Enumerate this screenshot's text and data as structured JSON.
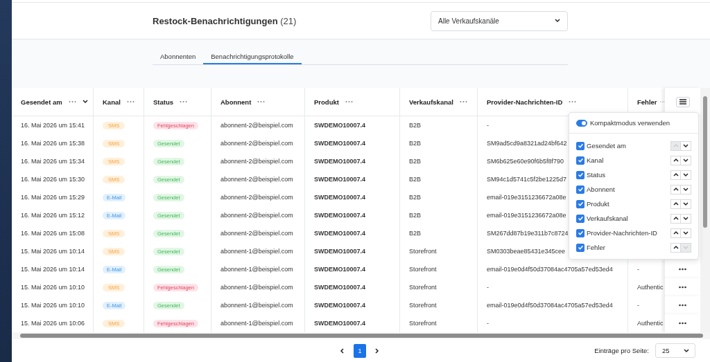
{
  "header": {
    "title": "Restock-Benachrichtigungen",
    "count": "(21)",
    "channel_select": "Alle Verkaufskanäle"
  },
  "tabs": [
    {
      "label": "Abonnenten",
      "selected": false
    },
    {
      "label": "Benachrichtigungsprotokolle",
      "selected": true
    }
  ],
  "table": {
    "columns": [
      {
        "label": "Gesendet am",
        "sortable": true
      },
      {
        "label": "Kanal"
      },
      {
        "label": "Status"
      },
      {
        "label": "Abonnent"
      },
      {
        "label": "Produkt"
      },
      {
        "label": "Verkaufskanal"
      },
      {
        "label": "Provider-Nachrichten-ID"
      },
      {
        "label": "Fehler"
      }
    ],
    "rows": [
      {
        "sent": "16. Mai 2026 um 15:41",
        "channel": {
          "label": "SMS",
          "kind": "sms"
        },
        "status": {
          "label": "Fehlgeschlagen",
          "kind": "failed"
        },
        "subscriber": "abonnent-2@beispiel.com",
        "product": "SWDEMO10007.4",
        "sales_channel": "B2B",
        "provider_id": "-"
      },
      {
        "sent": "16. Mai 2026 um 15:38",
        "channel": {
          "label": "SMS",
          "kind": "sms"
        },
        "status": {
          "label": "Gesendet",
          "kind": "sent"
        },
        "subscriber": "abonnent-2@beispiel.com",
        "product": "SWDEMO10007.4",
        "sales_channel": "B2B",
        "provider_id": "SM9ad5cd9a8321ad24bf642"
      },
      {
        "sent": "16. Mai 2026 um 15:34",
        "channel": {
          "label": "SMS",
          "kind": "sms"
        },
        "status": {
          "label": "Gesendet",
          "kind": "sent"
        },
        "subscriber": "abonnent-2@beispiel.com",
        "product": "SWDEMO10007.4",
        "sales_channel": "B2B",
        "provider_id": "SM6b625e60e90f6b5f8f790"
      },
      {
        "sent": "16. Mai 2026 um 15:30",
        "channel": {
          "label": "SMS",
          "kind": "sms"
        },
        "status": {
          "label": "Gesendet",
          "kind": "sent"
        },
        "subscriber": "abonnent-2@beispiel.com",
        "product": "SWDEMO10007.4",
        "sales_channel": "B2B",
        "provider_id": "SM94c1d5741c5f2be1225d7"
      },
      {
        "sent": "16. Mai 2026 um 15:29",
        "channel": {
          "label": "E-Mail",
          "kind": "email"
        },
        "status": {
          "label": "Gesendet",
          "kind": "sent"
        },
        "subscriber": "abonnent-2@beispiel.com",
        "product": "SWDEMO10007.4",
        "sales_channel": "B2B",
        "provider_id": "email-019e3151236672a08e"
      },
      {
        "sent": "16. Mai 2026 um 15:12",
        "channel": {
          "label": "E-Mail",
          "kind": "email"
        },
        "status": {
          "label": "Gesendet",
          "kind": "sent"
        },
        "subscriber": "abonnent-2@beispiel.com",
        "product": "SWDEMO10007.4",
        "sales_channel": "B2B",
        "provider_id": "email-019e3151236672a08e"
      },
      {
        "sent": "16. Mai 2026 um 15:08",
        "channel": {
          "label": "SMS",
          "kind": "sms"
        },
        "status": {
          "label": "Gesendet",
          "kind": "sent"
        },
        "subscriber": "abonnent-2@beispiel.com",
        "product": "SWDEMO10007.4",
        "sales_channel": "B2B",
        "provider_id": "SM267dd87b19e311b7c8724"
      },
      {
        "sent": "15. Mai 2026 um 10:14",
        "channel": {
          "label": "SMS",
          "kind": "sms"
        },
        "status": {
          "label": "Gesendet",
          "kind": "sent"
        },
        "subscriber": "abonnent-1@beispiel.com",
        "product": "SWDEMO10007.4",
        "sales_channel": "Storefront",
        "provider_id": "SM0303beae85431e345cee"
      },
      {
        "sent": "15. Mai 2026 um 10:14",
        "channel": {
          "label": "E-Mail",
          "kind": "email"
        },
        "status": {
          "label": "Gesendet",
          "kind": "sent"
        },
        "subscriber": "abonnent-1@beispiel.com",
        "product": "SWDEMO10007.4",
        "sales_channel": "Storefront",
        "provider_id": "email-019e0d4f50d37084ac4705a57ed53ed4",
        "error": "-"
      },
      {
        "sent": "15. Mai 2026 um 10:10",
        "channel": {
          "label": "SMS",
          "kind": "sms"
        },
        "status": {
          "label": "Fehlgeschlagen",
          "kind": "failed"
        },
        "subscriber": "abonnent-1@beispiel.com",
        "product": "SWDEMO10007.4",
        "sales_channel": "Storefront",
        "provider_id": "-",
        "error": "Authentic"
      },
      {
        "sent": "15. Mai 2026 um 10:10",
        "channel": {
          "label": "E-Mail",
          "kind": "email"
        },
        "status": {
          "label": "Gesendet",
          "kind": "sent"
        },
        "subscriber": "abonnent-1@beispiel.com",
        "product": "SWDEMO10007.4",
        "sales_channel": "Storefront",
        "provider_id": "email-019e0d4f50d37084ac4705a57ed53ed4",
        "error": "-"
      },
      {
        "sent": "15. Mai 2026 um 10:06",
        "channel": {
          "label": "SMS",
          "kind": "sms"
        },
        "status": {
          "label": "Fehlgeschlagen",
          "kind": "failed"
        },
        "subscriber": "abonnent-1@beispiel.com",
        "product": "SWDEMO10007.4",
        "sales_channel": "Storefront",
        "provider_id": "-",
        "error": "Authentic"
      }
    ]
  },
  "column_menu": {
    "compact": {
      "label": "Kompaktmodus verwenden",
      "on": true
    },
    "items": [
      {
        "label": "Gesendet am",
        "checked": true,
        "up_disabled": true,
        "down_disabled": false
      },
      {
        "label": "Kanal",
        "checked": true,
        "up_disabled": false,
        "down_disabled": false
      },
      {
        "label": "Status",
        "checked": true,
        "up_disabled": false,
        "down_disabled": false
      },
      {
        "label": "Abonnent",
        "checked": true,
        "up_disabled": false,
        "down_disabled": false
      },
      {
        "label": "Produkt",
        "checked": true,
        "up_disabled": false,
        "down_disabled": false
      },
      {
        "label": "Verkaufskanal",
        "checked": true,
        "up_disabled": false,
        "down_disabled": false
      },
      {
        "label": "Provider-Nachrichten-ID",
        "checked": true,
        "up_disabled": false,
        "down_disabled": false
      },
      {
        "label": "Fehler",
        "checked": true,
        "up_disabled": false,
        "down_disabled": true
      }
    ]
  },
  "pagination": {
    "pages": [
      {
        "label": "1",
        "selected": true
      }
    ],
    "per_page_label": "Einträge pro Seite:",
    "per_page": "25"
  }
}
